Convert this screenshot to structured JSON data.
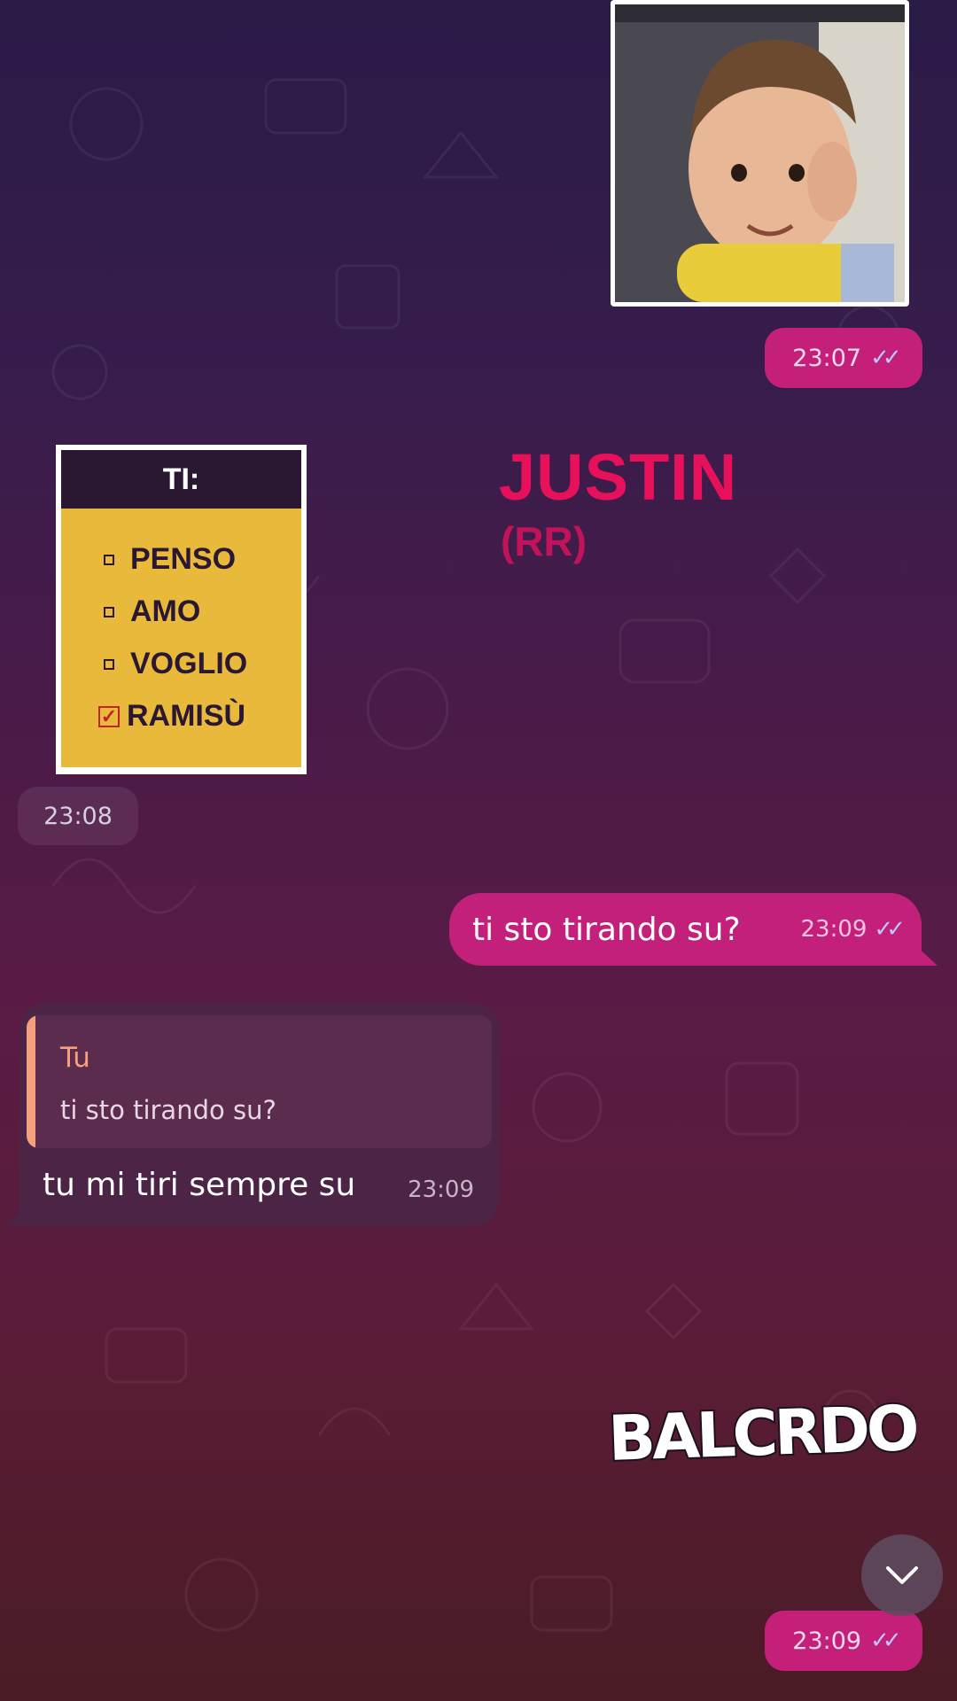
{
  "messages": [
    {
      "kind": "video-sticker",
      "direction": "outgoing",
      "time": "23:07",
      "status_icon": "double-check-icon"
    },
    {
      "kind": "image-sticker",
      "direction": "incoming",
      "time": "23:08",
      "sticker": {
        "header": "TI:",
        "options": [
          "PENSO",
          "AMO",
          "VOGLIO",
          "RAMISÙ"
        ],
        "checked_index": 3
      }
    },
    {
      "kind": "text",
      "direction": "outgoing",
      "text": "ti sto tirando su?",
      "time": "23:09",
      "status_icon": "double-check-icon"
    },
    {
      "kind": "reply",
      "direction": "incoming",
      "quote": {
        "author": "Tu",
        "text": "ti sto tirando su?"
      },
      "text": "tu mi tiri sempre su",
      "time": "23:09"
    },
    {
      "kind": "sticker",
      "direction": "outgoing",
      "time": "23:09",
      "status_icon": "double-check-icon"
    }
  ],
  "overlay": {
    "title": "JUSTIN",
    "subtitle": "(RR)",
    "watermark": "BALCRDO"
  },
  "controls": {
    "scroll_down_icon": "chevron-down-icon"
  },
  "colors": {
    "outgoing_bubble": "#c2207a",
    "incoming_bubble": "#4b2446",
    "quote_accent": "#f4a07e",
    "overlay_title": "#e6115a"
  }
}
